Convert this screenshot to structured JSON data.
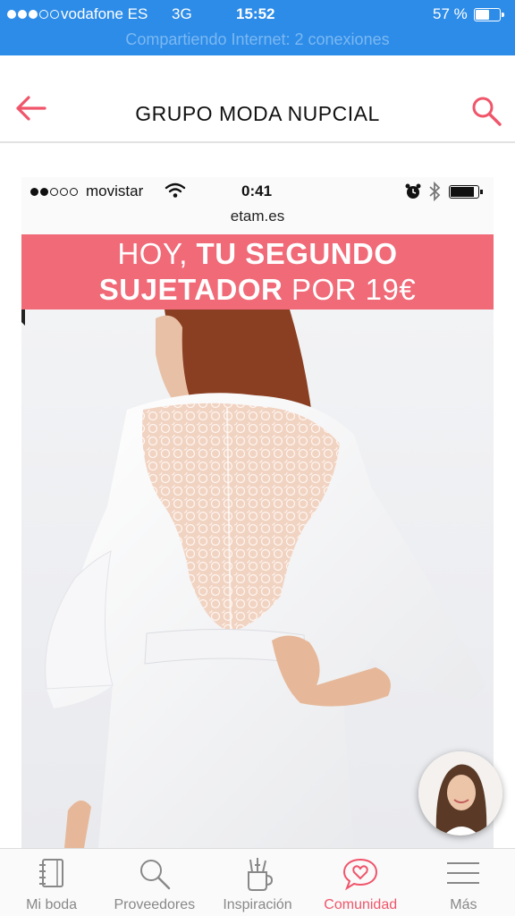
{
  "status_bar": {
    "carrier": "vodafone ES",
    "network": "3G",
    "time": "15:52",
    "battery": "57 %",
    "battery_level": 0.57,
    "hotspot": "Compartiendo Internet: 2 conexiones"
  },
  "header": {
    "title": "GRUPO MODA NUPCIAL",
    "back_icon": "arrow-left-icon",
    "search_icon": "search-icon",
    "accent_color": "#f0556a"
  },
  "post_image": {
    "status_bar": {
      "carrier": "movistar",
      "time": "0:41",
      "url": "etam.es"
    },
    "promo": {
      "line1_regular": "HOY, ",
      "line1_bold": "TU SEGUNDO",
      "line2_bold": "SUJETADOR",
      "line2_regular": " POR 19€",
      "background": "#f06a78"
    }
  },
  "tabbar": {
    "items": [
      {
        "label": "Mi boda",
        "icon": "notebook-icon"
      },
      {
        "label": "Proveedores",
        "icon": "search-icon"
      },
      {
        "label": "Inspiración",
        "icon": "inspiration-icon"
      },
      {
        "label": "Comunidad",
        "icon": "chat-heart-icon",
        "active": true
      },
      {
        "label": "Más",
        "icon": "menu-icon"
      }
    ]
  }
}
